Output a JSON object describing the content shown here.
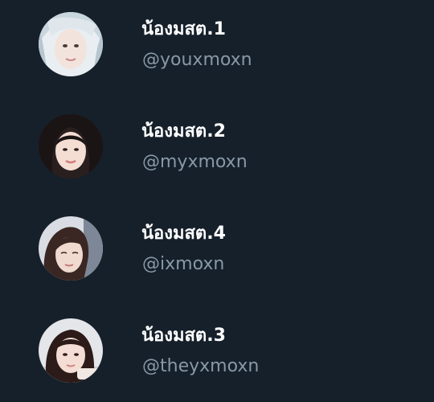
{
  "colors": {
    "background": "#16202b",
    "display_name": "#ffffff",
    "handle": "#8899a6"
  },
  "users": [
    {
      "display_name": "น้องมสต.1",
      "handle": "@youxmoxn",
      "avatar_icon": "profile-photo-avatar"
    },
    {
      "display_name": "น้องมสต.2",
      "handle": "@myxmoxn",
      "avatar_icon": "profile-photo-avatar"
    },
    {
      "display_name": "น้องมสต.4",
      "handle": "@ixmoxn",
      "avatar_icon": "profile-photo-avatar"
    },
    {
      "display_name": "น้องมสต.3",
      "handle": "@theyxmoxn",
      "avatar_icon": "profile-photo-avatar"
    }
  ]
}
